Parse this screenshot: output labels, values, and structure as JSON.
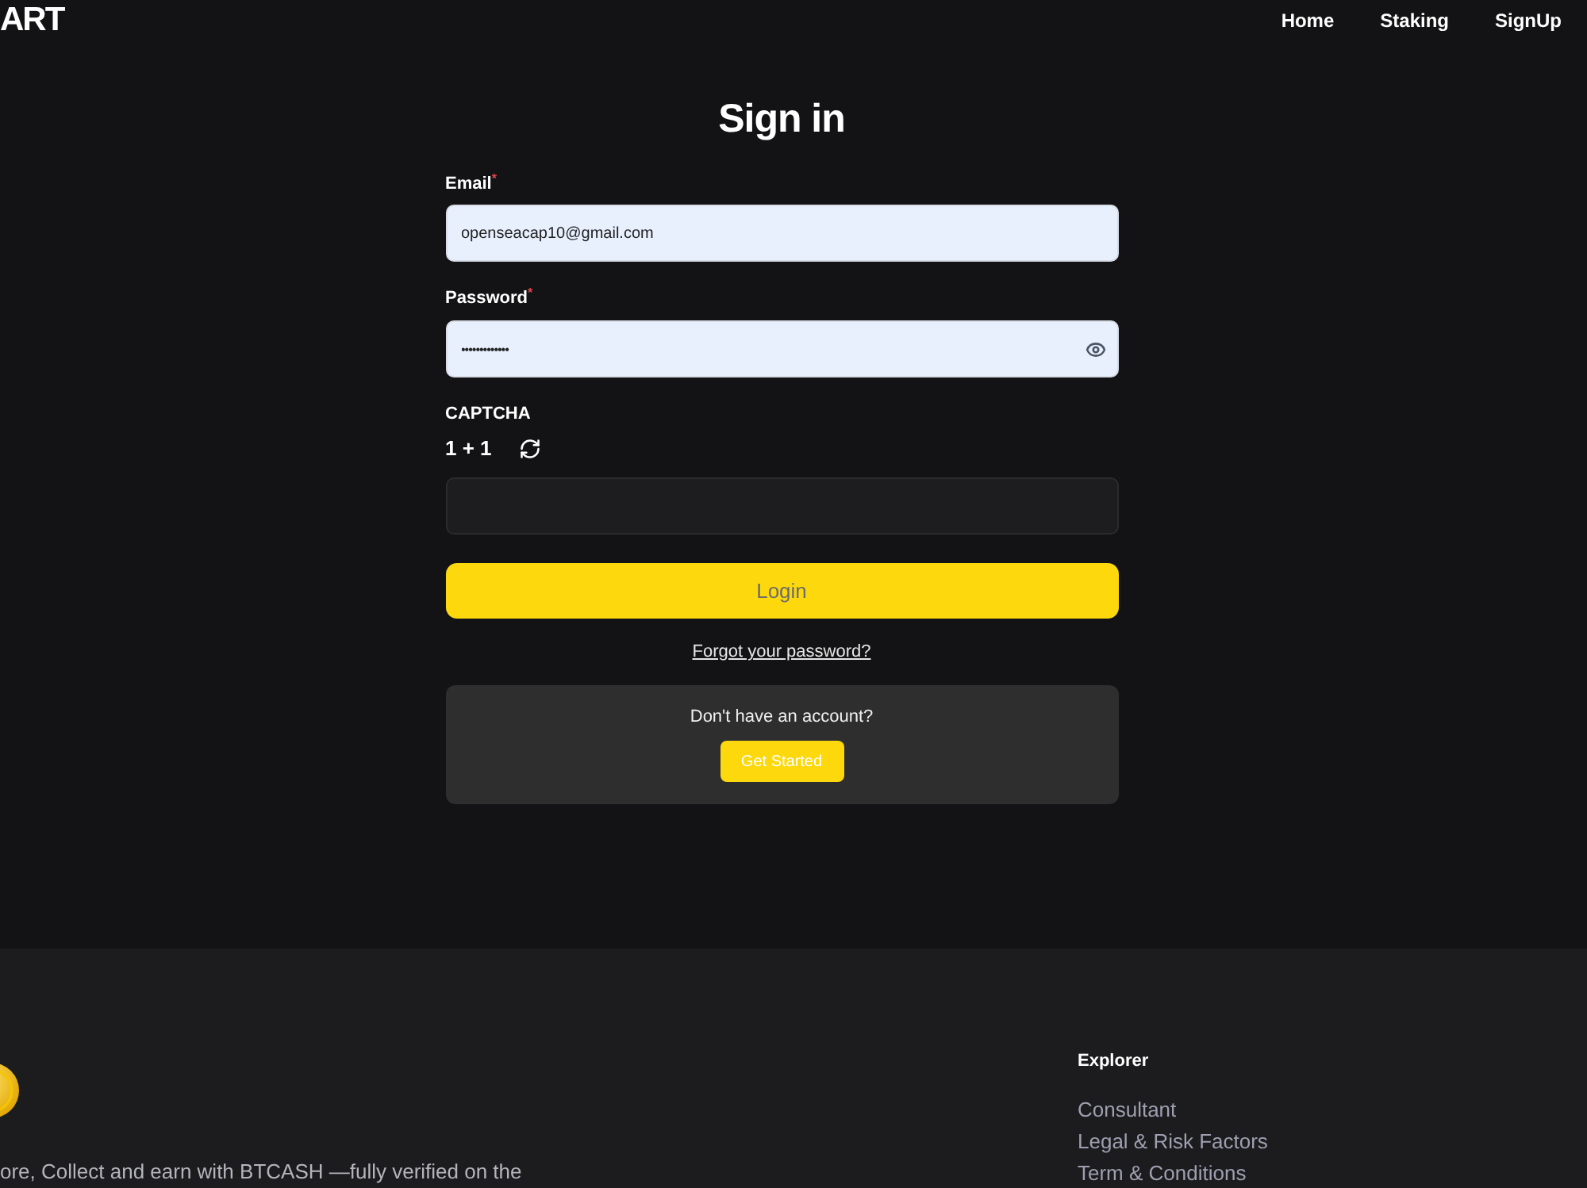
{
  "header": {
    "logo": "ART",
    "nav": [
      {
        "label": "Home"
      },
      {
        "label": "Staking"
      },
      {
        "label": "SignUp"
      }
    ]
  },
  "form": {
    "title": "Sign in",
    "fields": [
      {
        "kind": "email",
        "label": "Email$^{*}$",
        "value": "openseacap10@gmail.com"
      },
      {
        "kind": "password",
        "label": "Password$^{*}$",
        "value": "•••••••••••••"
      }
    ],
    "captcha": {
      "label": "CAPTCHA",
      "question": "1 + 1"
    },
    "submit": "Login",
    "forgot_link": "Forgot your password?",
    "signup_card": {
      "text": "Don't have an account?",
      "button": "Get Started"
    }
  },
  "footer": {
    "tagline": "ore, Collect and earn with BTCASH —fully verified on the",
    "columns": [
      {
        "title": "Explorer",
        "links": [
          "Consultant",
          "Legal & Risk Factors",
          "Term & Conditions"
        ]
      }
    ]
  }
}
